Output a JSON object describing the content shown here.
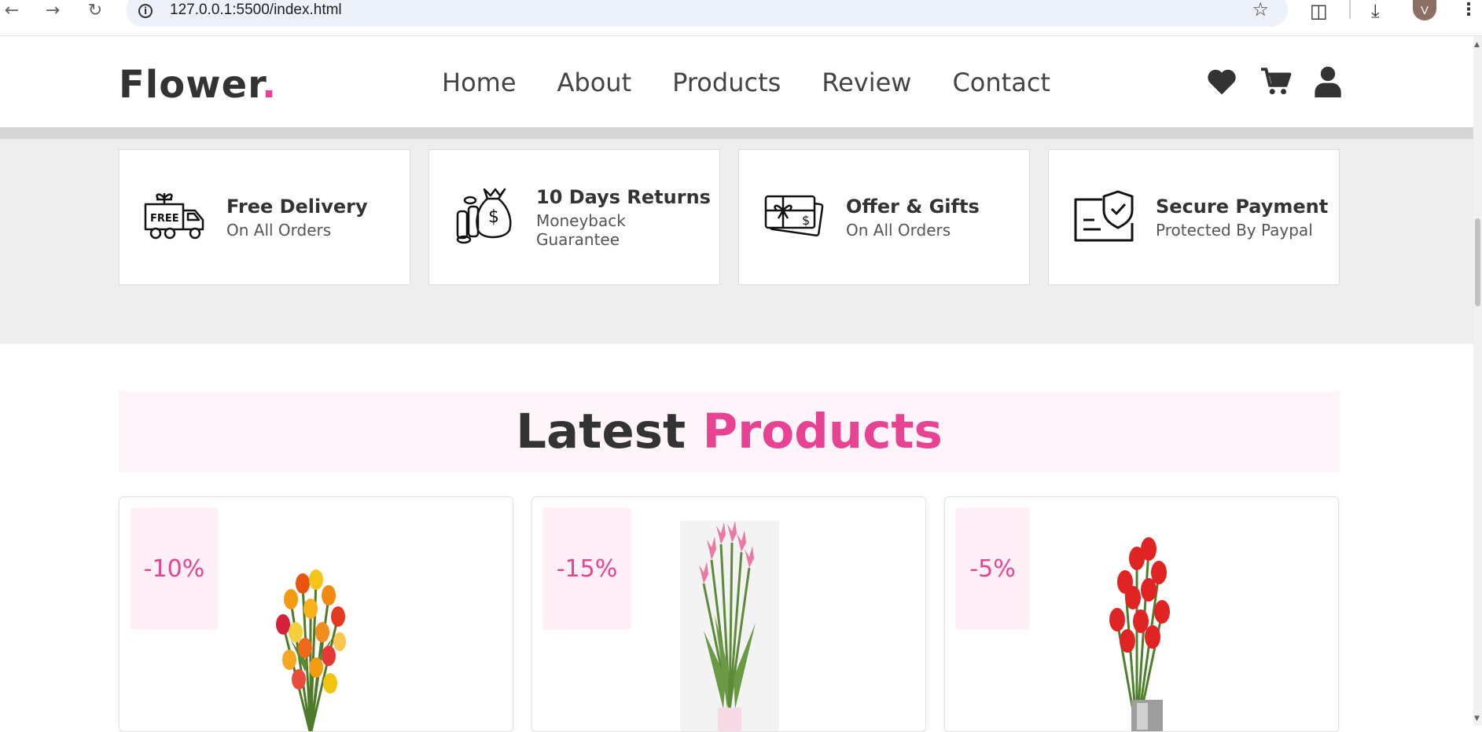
{
  "browser": {
    "url": "127.0.0.1:5500/index.html",
    "avatar_letter": "V"
  },
  "header": {
    "logo_text": "Flower",
    "logo_dot": ".",
    "nav": [
      "Home",
      "About",
      "Products",
      "Review",
      "Contact"
    ]
  },
  "features": [
    {
      "title": "Free Delivery",
      "subtitle": "On All Orders",
      "icon": "delivery-truck-icon"
    },
    {
      "title": "10 Days Returns",
      "subtitle": "Moneyback Guarantee",
      "icon": "money-bag-icon"
    },
    {
      "title": "Offer & Gifts",
      "subtitle": "On All Orders",
      "icon": "gift-card-icon"
    },
    {
      "title": "Secure Payment",
      "subtitle": "Protected By Paypal",
      "icon": "secure-shield-icon"
    }
  ],
  "latest": {
    "heading_word1": "Latest",
    "heading_word2": "Products"
  },
  "products": [
    {
      "discount": "-10%"
    },
    {
      "discount": "-15%"
    },
    {
      "discount": "-5%"
    }
  ],
  "colors": {
    "accent": "#e84393",
    "text": "#333333",
    "band": "#eeeeee",
    "heading_bg": "#fff4fa"
  }
}
